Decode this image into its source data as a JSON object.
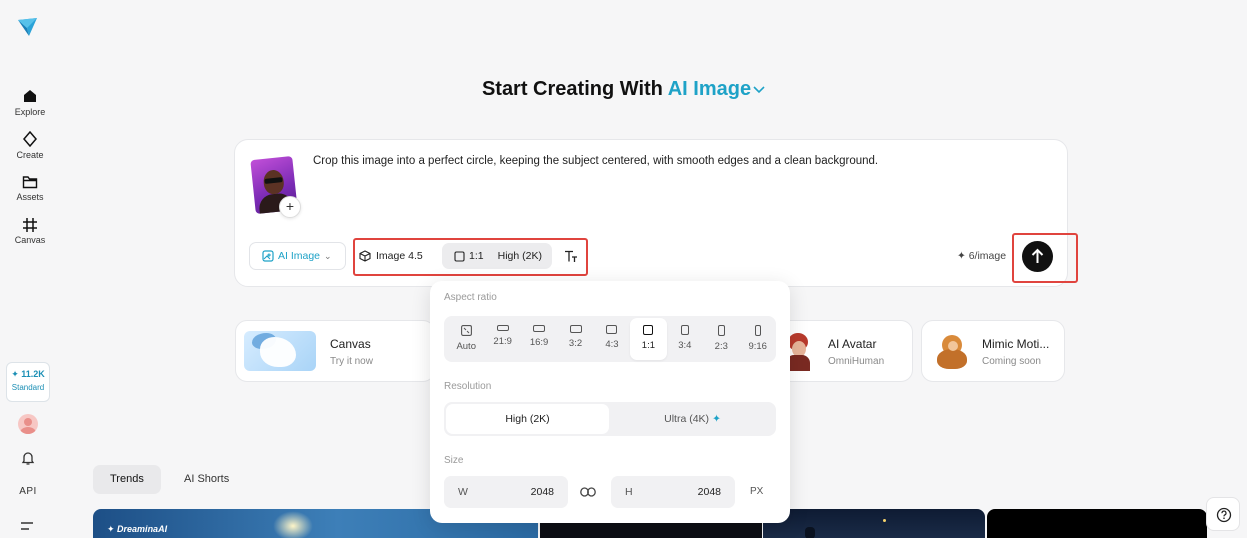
{
  "sidebar": {
    "logo": "dreamina-logo-icon",
    "items": [
      {
        "label": "Explore",
        "icon": "home-icon"
      },
      {
        "label": "Create",
        "icon": "sparkle-icon"
      },
      {
        "label": "Assets",
        "icon": "folder-icon"
      },
      {
        "label": "Canvas",
        "icon": "canvas-grid-icon"
      }
    ],
    "credits": {
      "amount": "11.2K",
      "plan": "Standard"
    },
    "api_label": "API"
  },
  "heading": {
    "prefix": "Start Creating With",
    "accent": "AI Image"
  },
  "prompt": {
    "text": "Crop this image into a perfect circle, keeping the subject centered, with smooth edges and a clean background.",
    "add_label": "+",
    "mode_label": "AI Image",
    "model_label": "Image 4.5",
    "ratio_label": "1:1",
    "resolution_label": "High (2K)",
    "credits_label": "6/image"
  },
  "features": [
    {
      "title": "Canvas",
      "subtitle": "Try it now"
    },
    {
      "title": "AI Avatar",
      "subtitle": "OmniHuman"
    },
    {
      "title": "Mimic Moti...",
      "subtitle": "Coming soon"
    }
  ],
  "tabs": [
    {
      "label": "Trends",
      "active": true
    },
    {
      "label": "AI Shorts",
      "active": false
    }
  ],
  "gallery": {
    "watermark": "DreaminaAI"
  },
  "dropdown": {
    "aspect_label": "Aspect ratio",
    "ratios": [
      "Auto",
      "21:9",
      "16:9",
      "3:2",
      "4:3",
      "1:1",
      "3:4",
      "2:3",
      "9:16"
    ],
    "selected_ratio": "1:1",
    "resolution_label": "Resolution",
    "resolutions": [
      "High (2K)",
      "Ultra (4K)"
    ],
    "selected_resolution": "High (2K)",
    "size_label": "Size",
    "width_key": "W",
    "width_value": "2048",
    "height_key": "H",
    "height_value": "2048",
    "unit": "PX"
  },
  "colors": {
    "accent": "#1ea2c7",
    "highlight": "#e0443e"
  }
}
